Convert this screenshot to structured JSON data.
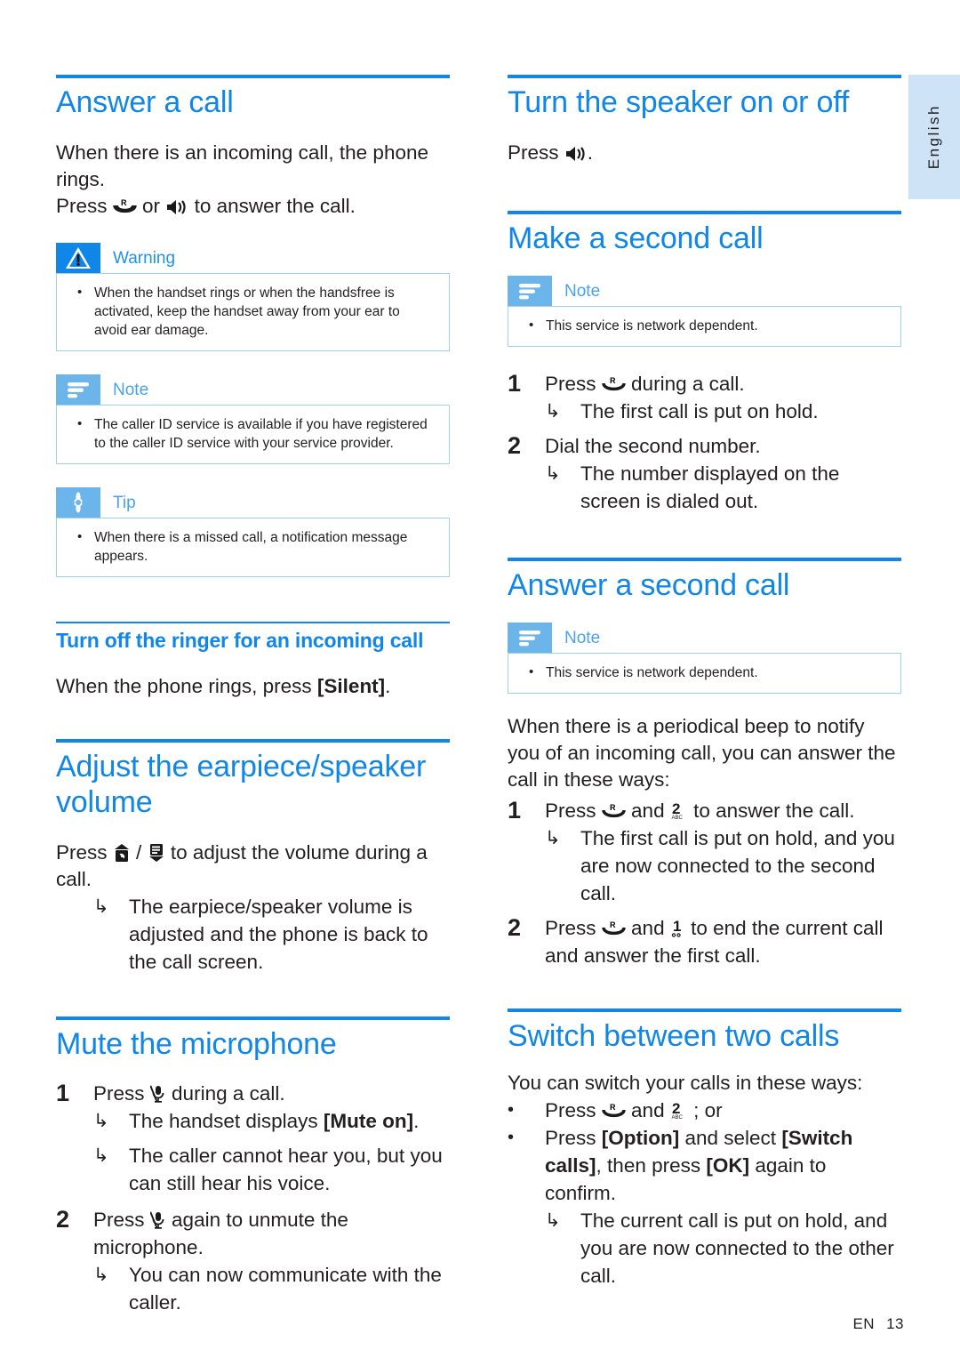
{
  "language_tab": {
    "label": "English"
  },
  "footer": {
    "locale": "EN",
    "page_number": "13"
  },
  "left_column": {
    "answer_a_call": {
      "heading": "Answer a call",
      "intro_line1": "When there is an incoming call, the phone rings.",
      "intro_press": "Press",
      "intro_or": "or",
      "intro_tail": "to answer the call.",
      "warning": {
        "title": "Warning",
        "items": [
          "When the handset rings or when the handsfree is activated, keep the handset away from your ear to avoid ear damage."
        ]
      },
      "note": {
        "title": "Note",
        "items": [
          "The caller ID service is available if you have registered to the caller ID service with your service provider."
        ]
      },
      "tip": {
        "title": "Tip",
        "items": [
          "When there is a missed call, a notification message appears."
        ]
      }
    },
    "turn_off_ringer": {
      "heading": "Turn off the ringer for an incoming call",
      "body_prefix": "When the phone rings, press ",
      "body_key": "[Silent]",
      "body_suffix": "."
    },
    "adjust_volume": {
      "heading": "Adjust the earpiece/speaker volume",
      "press_label": "Press",
      "slash": "/",
      "press_tail": "to adjust the volume during a call.",
      "result": "The earpiece/speaker volume is adjusted and the phone is back to the call screen."
    },
    "mute_microphone": {
      "heading": "Mute the microphone",
      "steps": [
        {
          "number": "1",
          "text_before": "Press",
          "text_after": "during a call.",
          "results": [
            {
              "prefix": "The handset displays ",
              "bold": "[Mute on]",
              "suffix": "."
            },
            {
              "prefix": "The caller cannot hear you, but you can still hear his voice.",
              "bold": "",
              "suffix": ""
            }
          ]
        },
        {
          "number": "2",
          "text_before": "Press",
          "text_after": "again to unmute the microphone.",
          "results": [
            {
              "prefix": "You can now communicate with the caller.",
              "bold": "",
              "suffix": ""
            }
          ]
        }
      ]
    }
  },
  "right_column": {
    "turn_speaker": {
      "heading": "Turn the speaker on or off",
      "press_label": "Press",
      "press_tail": "."
    },
    "make_second_call": {
      "heading": "Make a second call",
      "note": {
        "title": "Note",
        "items": [
          "This service is network dependent."
        ]
      },
      "steps": [
        {
          "number": "1",
          "text_before": "Press",
          "text_after": "during a call.",
          "results": [
            "The first call is put on hold."
          ]
        },
        {
          "number": "2",
          "text_before": "Dial the second number.",
          "text_after": "",
          "results": [
            "The number displayed on the screen is dialed out."
          ]
        }
      ]
    },
    "answer_second_call": {
      "heading": "Answer a second call",
      "note": {
        "title": "Note",
        "items": [
          "This service is network dependent."
        ]
      },
      "intro": "When there is a periodical beep to notify you of an incoming call, you can answer the call in these ways:",
      "steps": [
        {
          "number": "1",
          "text_before": "Press",
          "text_mid": "and",
          "text_after": "to answer the call.",
          "results": [
            "The first call is put on hold, and you are now connected to the second call."
          ]
        },
        {
          "number": "2",
          "text_before": "Press",
          "text_mid": "and",
          "text_after": "to end the current call and answer the first call.",
          "results": []
        }
      ]
    },
    "switch_calls": {
      "heading": "Switch between two calls",
      "intro": "You can switch your calls in these ways:",
      "bullet1": {
        "before": "Press",
        "mid": "and",
        "after": "; or"
      },
      "bullet2": {
        "before": "Press ",
        "key1": "[Option]",
        "mid": " and select ",
        "key2": "[Switch calls]",
        "tail": ", then press ",
        "key3": "[OK]",
        "end": " again to confirm."
      },
      "bullet2_result": "The current call is put on hold, and you are now connected to the other call."
    }
  },
  "icons": {
    "talk_key": "talk-key-icon",
    "speaker_key": "speaker-key-icon",
    "volume_up_key": "volume-up-key-icon",
    "volume_down_key": "volume-down-key-icon",
    "mute_key": "mute-microphone-key-icon",
    "key_two_abc": "keypad-2-abc-icon",
    "key_one": "keypad-1-icon"
  },
  "colors": {
    "accent_blue": "#0f86e8",
    "note_badge": "#6cb5ea",
    "warning_badge": "#0f86e8",
    "callout_border": "#9ed0f2",
    "tab_background": "#cfe3f7",
    "text": "#231f20"
  }
}
